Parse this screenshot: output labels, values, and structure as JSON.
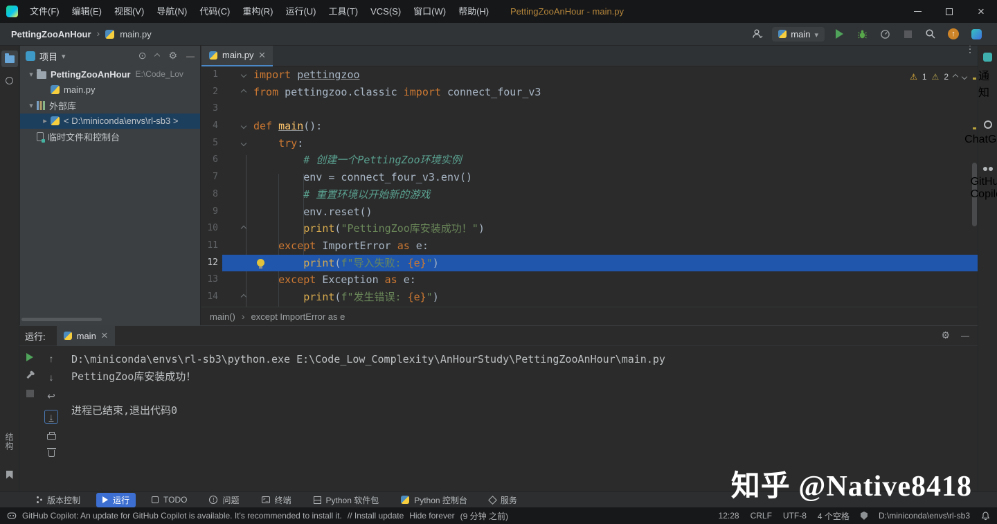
{
  "colors": {
    "selection_blue": "#2057ad",
    "tree_selection": "#1d3f5e",
    "active_toolwindow_blue": "#3c6fd1",
    "keyword_orange": "#cc7832",
    "string_green": "#6a8759",
    "comment_teal": "#5aa08f",
    "warning_yellow": "#e8b63c",
    "title_amber": "#b4863b"
  },
  "title_bar": {
    "menus": [
      "文件(F)",
      "编辑(E)",
      "视图(V)",
      "导航(N)",
      "代码(C)",
      "重构(R)",
      "运行(U)",
      "工具(T)",
      "VCS(S)",
      "窗口(W)",
      "帮助(H)"
    ],
    "title": "PettingZooAnHour - main.py"
  },
  "nav_bar": {
    "crumb_project": "PettingZooAnHour",
    "crumb_file": "main.py",
    "run_config_label": "main"
  },
  "left_strip": {
    "structure_label": "结构"
  },
  "right_strip": [
    {
      "name": "notifications",
      "icon": "notifications-icon",
      "label": "通知"
    },
    {
      "name": "chatgpt",
      "icon": "chatgpt-icon",
      "label": "ChatGPT"
    },
    {
      "name": "github-copilot",
      "icon": "copilot-icon",
      "label": "GitHub Copilot"
    }
  ],
  "project_panel": {
    "title": "项目",
    "tree": [
      {
        "label": "PettingZooAnHour",
        "hint": "E:\\Code_Lov",
        "icon": "folder",
        "arrow": "down",
        "indent": 0,
        "bold": true
      },
      {
        "label": "main.py",
        "icon": "python",
        "indent": 1
      },
      {
        "label": "外部库",
        "icon": "library",
        "arrow": "down",
        "indent": 0
      },
      {
        "label": "< D:\\miniconda\\envs\\rl-sb3 >",
        "icon": "python",
        "arrow": "right",
        "indent": 1,
        "selected": true
      },
      {
        "label": "临时文件和控制台",
        "icon": "scratch",
        "indent": 0
      }
    ]
  },
  "editor": {
    "tab_label": "main.py",
    "warning_count_1": "1",
    "warning_count_2": "2",
    "breadcrumb_fn": "main()",
    "breadcrumb_node": "except ImportError as e",
    "code": [
      {
        "n": "1",
        "fold": "down",
        "tokens": [
          [
            "k",
            "import"
          ],
          [
            "p",
            " "
          ],
          [
            "pu",
            "pettingzoo"
          ]
        ]
      },
      {
        "n": "2",
        "fold": "up",
        "tokens": [
          [
            "k",
            "from"
          ],
          [
            "p",
            " pettingzoo.classic "
          ],
          [
            "k",
            "import"
          ],
          [
            "p",
            " connect_four_v3"
          ]
        ]
      },
      {
        "n": "3",
        "tokens": []
      },
      {
        "n": "4",
        "fold": "down",
        "tokens": [
          [
            "k",
            "def"
          ],
          [
            "p",
            " "
          ],
          [
            "fu",
            "main"
          ],
          [
            "p",
            "():"
          ]
        ]
      },
      {
        "n": "5",
        "fold": "down",
        "tokens": [
          [
            "p",
            "    "
          ],
          [
            "k",
            "try"
          ],
          [
            "p",
            ":"
          ]
        ]
      },
      {
        "n": "6",
        "tokens": [
          [
            "p",
            "        "
          ],
          [
            "c",
            "# 创建一个PettingZoo环境实例"
          ]
        ]
      },
      {
        "n": "7",
        "tokens": [
          [
            "p",
            "        env = connect_four_v3.env()"
          ]
        ]
      },
      {
        "n": "8",
        "tokens": [
          [
            "p",
            "        "
          ],
          [
            "c",
            "# 重置环境以开始新的游戏"
          ]
        ]
      },
      {
        "n": "9",
        "tokens": [
          [
            "p",
            "        env.reset()"
          ]
        ]
      },
      {
        "n": "10",
        "fold": "up",
        "tokens": [
          [
            "p",
            "        "
          ],
          [
            "b",
            "print"
          ],
          [
            "p",
            "("
          ],
          [
            "s",
            "\"PettingZoo库安装成功！\""
          ],
          [
            "p",
            ")"
          ]
        ]
      },
      {
        "n": "11",
        "tokens": [
          [
            "p",
            "    "
          ],
          [
            "k",
            "except"
          ],
          [
            "p",
            " ImportError "
          ],
          [
            "k",
            "as"
          ],
          [
            "p",
            " e:"
          ]
        ]
      },
      {
        "n": "12",
        "sel": true,
        "bulb": true,
        "tokens": [
          [
            "p",
            "        "
          ],
          [
            "b",
            "print"
          ],
          [
            "p",
            "("
          ],
          [
            "s",
            "f\"导入失败: "
          ],
          [
            "br",
            "{e}"
          ],
          [
            "s",
            "\""
          ],
          [
            "p",
            ")"
          ]
        ]
      },
      {
        "n": "13",
        "tokens": [
          [
            "p",
            "    "
          ],
          [
            "k",
            "except"
          ],
          [
            "p",
            " Exception "
          ],
          [
            "k",
            "as"
          ],
          [
            "p",
            " e:"
          ]
        ]
      },
      {
        "n": "14",
        "fold": "up",
        "tokens": [
          [
            "p",
            "        "
          ],
          [
            "b",
            "print"
          ],
          [
            "p",
            "("
          ],
          [
            "s",
            "f\"发生错误: "
          ],
          [
            "br",
            "{e}"
          ],
          [
            "s",
            "\""
          ],
          [
            "p",
            ")"
          ]
        ]
      }
    ]
  },
  "run_panel": {
    "title": "运行:",
    "tab_label": "main",
    "console": [
      "D:\\miniconda\\envs\\rl-sb3\\python.exe E:\\Code_Low_Complexity\\AnHourStudy\\PettingZooAnHour\\main.py",
      "PettingZoo库安装成功！",
      "",
      "进程已结束,退出代码0"
    ]
  },
  "bottom_bar": [
    {
      "name": "version-control",
      "label": "版本控制",
      "icon": "branch-icon"
    },
    {
      "name": "run",
      "label": "运行",
      "icon": "play-icon",
      "active": true
    },
    {
      "name": "todo",
      "label": "TODO",
      "icon": "todo-icon"
    },
    {
      "name": "problems",
      "label": "问题",
      "icon": "problems-icon"
    },
    {
      "name": "terminal",
      "label": "终端",
      "icon": "terminal-icon"
    },
    {
      "name": "python-packages",
      "label": "Python 软件包",
      "icon": "packages-icon"
    },
    {
      "name": "python-console",
      "label": "Python 控制台",
      "icon": "python-console-icon"
    },
    {
      "name": "services",
      "label": "服务",
      "icon": "services-icon"
    }
  ],
  "status_bar": {
    "copilot_message": "GitHub Copilot: An update for GitHub Copilot is available. It's recommended to install it.",
    "install_link": "// Install update",
    "hide_link": "Hide forever",
    "time_ago": "(9 分钟 之前)",
    "clock": "12:28",
    "line_ending": "CRLF",
    "encoding": "UTF-8",
    "indent": "4 个空格",
    "interpreter_path": "D:\\miniconda\\envs\\rl-sb3"
  },
  "watermark": "知乎 @Native8418"
}
